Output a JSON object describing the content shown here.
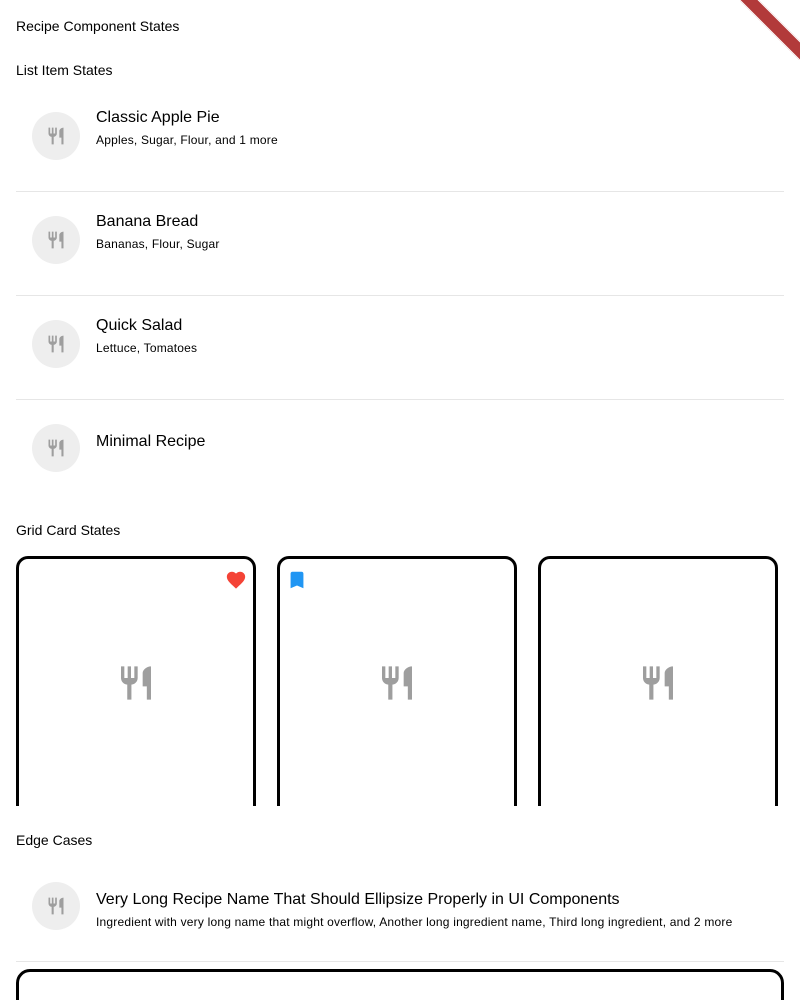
{
  "page": {
    "title": "Recipe Component States"
  },
  "list_section": {
    "title": "List Item States",
    "items": [
      {
        "title": "Classic Apple Pie",
        "subtitle": "Apples, Sugar, Flour, and 1 more",
        "icon": "restaurant-icon"
      },
      {
        "title": "Banana Bread",
        "subtitle": "Bananas, Flour, Sugar",
        "icon": "restaurant-icon"
      },
      {
        "title": "Quick Salad",
        "subtitle": "Lettuce, Tomatoes",
        "icon": "restaurant-icon"
      },
      {
        "title": "Minimal Recipe",
        "subtitle": "",
        "icon": "restaurant-icon"
      }
    ]
  },
  "grid_section": {
    "title": "Grid Card States",
    "cards": [
      {
        "icon": "restaurant-icon",
        "badge": "favorite-heart-icon",
        "badge_color": "#f44336"
      },
      {
        "icon": "restaurant-icon",
        "badge": "bookmark-icon",
        "badge_color": "#2196f3"
      },
      {
        "icon": "restaurant-icon",
        "badge": "",
        "badge_color": ""
      }
    ]
  },
  "edge_section": {
    "title": "Edge Cases",
    "items": [
      {
        "title": "Very Long Recipe Name That Should Ellipsize Properly in UI Components",
        "subtitle": "Ingredient with very long name that might overflow, Another long ingredient name, Third long ingredient, and 2 more",
        "icon": "restaurant-icon"
      }
    ]
  },
  "colors": {
    "icon_grey": "#9e9e9e",
    "avatar_bg": "#eeeeee",
    "divider": "#e6e6e6",
    "debug_banner": "#b23a3a"
  }
}
